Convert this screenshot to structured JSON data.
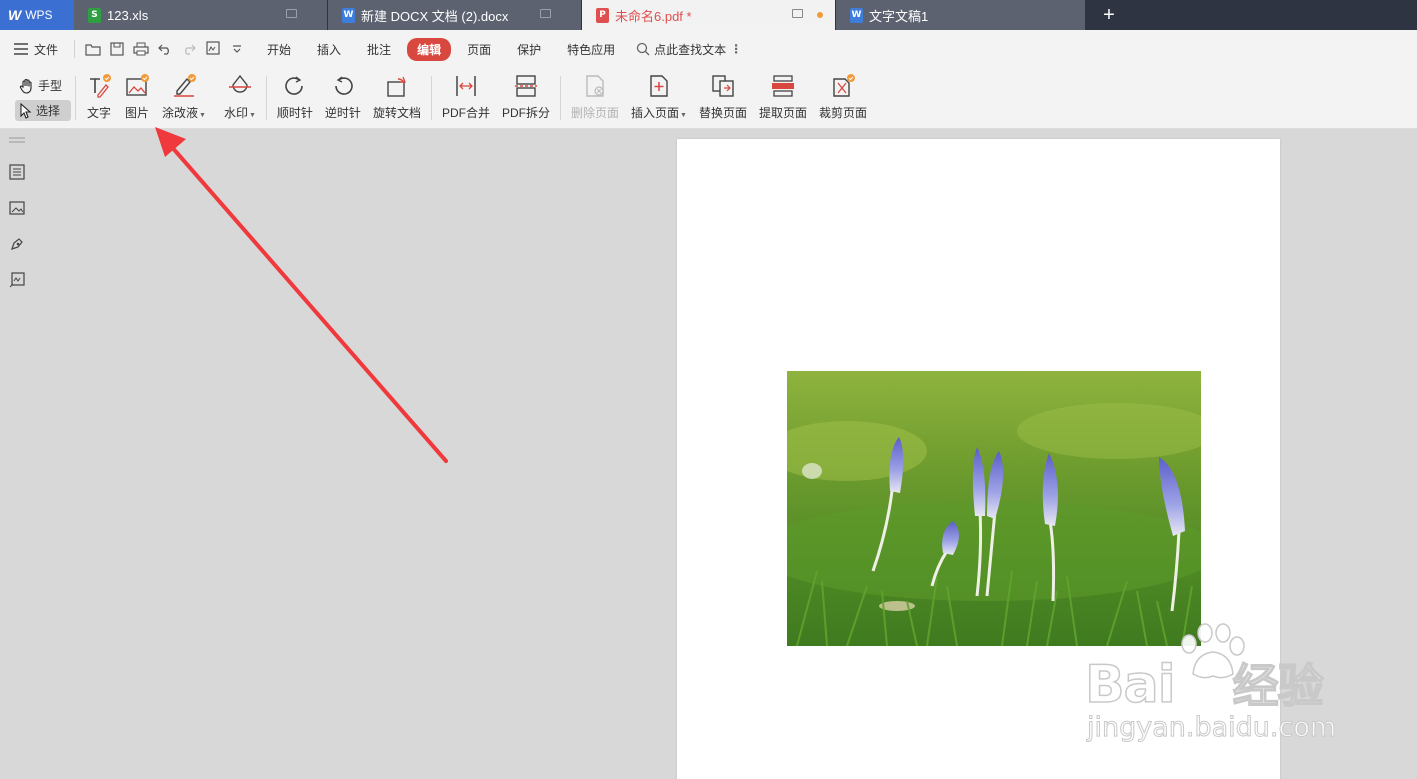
{
  "app": {
    "logo_text": "WPS"
  },
  "tabs": [
    {
      "label": "123.xls",
      "icon": "S",
      "color": "#2ea043"
    },
    {
      "label": "新建 DOCX 文档 (2).docx",
      "icon": "W",
      "color": "#3f7ddc"
    },
    {
      "label": "未命名6.pdf *",
      "icon": "P",
      "color": "#e04f4f"
    },
    {
      "label": "文字文稿1",
      "icon": "W",
      "color": "#3f7ddc"
    }
  ],
  "menubar": {
    "file_label": "文件",
    "items": [
      "开始",
      "插入",
      "批注",
      "编辑",
      "页面",
      "保护",
      "特色应用"
    ],
    "active": "编辑",
    "search_label": "点此查找文本"
  },
  "ribbon": {
    "hand_label": "手型",
    "select_label": "选择",
    "buttons": [
      "文字",
      "图片",
      "涂改液",
      "水印",
      "顺时针",
      "逆时针",
      "旋转文档",
      "PDF合并",
      "PDF拆分",
      "删除页面",
      "插入页面",
      "替换页面",
      "提取页面",
      "裁剪页面"
    ]
  },
  "watermark": {
    "brand": "Bai",
    "brand_cn": "经验",
    "url": "jingyan.baidu.com"
  },
  "colors": {
    "accent": "#d8483e",
    "arrow": "#f0393c"
  }
}
